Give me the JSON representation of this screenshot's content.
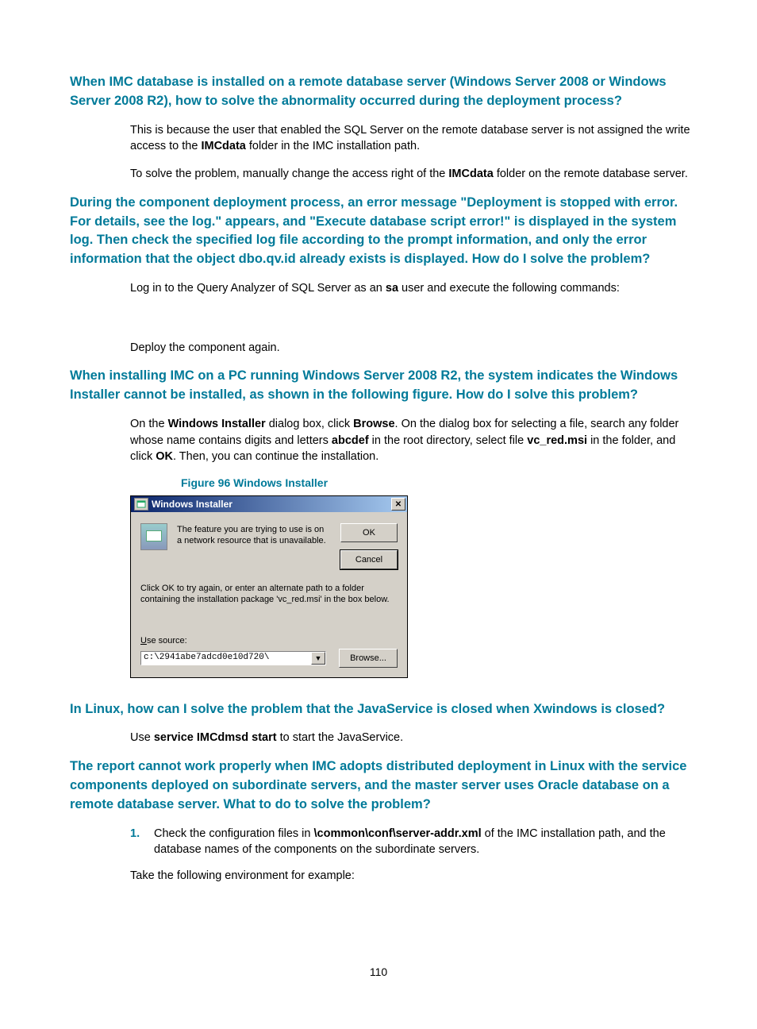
{
  "headings": {
    "h1": "When IMC database is installed on a remote database server (Windows Server 2008 or Windows Server 2008 R2), how to solve the abnormality occurred during the deployment process?",
    "h2": "During the component deployment process, an error message \"Deployment is stopped with error. For details, see the log.\" appears, and \"Execute database script error!\" is displayed in the system log. Then check the specified log file according to the prompt information, and only the error information that the object dbo.qv.id already exists is displayed. How do I solve the problem?",
    "h3": "When installing IMC on a PC running Windows Server 2008 R2, the system indicates the Windows Installer cannot be installed, as shown in the following figure. How do I solve this problem?",
    "h4": "In Linux, how can I solve the problem that the JavaService is closed when Xwindows is closed?",
    "h5": "The report cannot work properly when IMC adopts distributed deployment in Linux with the service components deployed on subordinate servers, and the master server uses Oracle database on a remote database server. What to do to solve the problem?"
  },
  "body": {
    "p1a": "This is because the user that enabled the SQL Server on the remote database server is not assigned the write access to the ",
    "p1b": "IMCdata",
    "p1c": " folder in the IMC installation path.",
    "p2a": "To solve the problem, manually change the access right of the ",
    "p2b": "IMCdata",
    "p2c": " folder on the remote database server.",
    "p3a": "Log in to the Query Analyzer of SQL Server as an ",
    "p3b": "sa",
    "p3c": " user and execute the following commands:",
    "p4": "Deploy the component again.",
    "p5a": "On the ",
    "p5b": "Windows Installer",
    "p5c": " dialog box, click ",
    "p5d": "Browse",
    "p5e": ". On the dialog box for selecting a file, search any folder whose name contains digits and letters ",
    "p5f": "abcdef",
    "p5g": " in the root directory, select file ",
    "p5h": "vc_red.msi",
    "p5i": " in the folder, and click ",
    "p5j": "OK",
    "p5k": ". Then, you can continue the installation.",
    "fig_caption": "Figure 96 Windows Installer",
    "p6a": "Use ",
    "p6b": "service IMCdmsd start",
    "p6c": " to start the JavaService.",
    "ol1_num": "1.",
    "ol1a": "Check the configuration files in ",
    "ol1b": "\\common\\conf\\server-addr.xml",
    "ol1c": " of the IMC installation path, and the database names of the components on the subordinate servers.",
    "p7": "Take the following environment for example:"
  },
  "dialog": {
    "title": "Windows Installer",
    "close": "✕",
    "msg": "The feature you are trying to use is on a network resource that is unavailable.",
    "ok": "OK",
    "cancel": "Cancel",
    "note": "Click OK to try again, or enter an alternate path to a folder containing the installation package 'vc_red.msi' in the box below.",
    "use_source": "Use source:",
    "path": "c:\\2941abe7adcd0e10d720\\",
    "arrow": "▼",
    "browse": "Browse..."
  },
  "page_number": "110"
}
